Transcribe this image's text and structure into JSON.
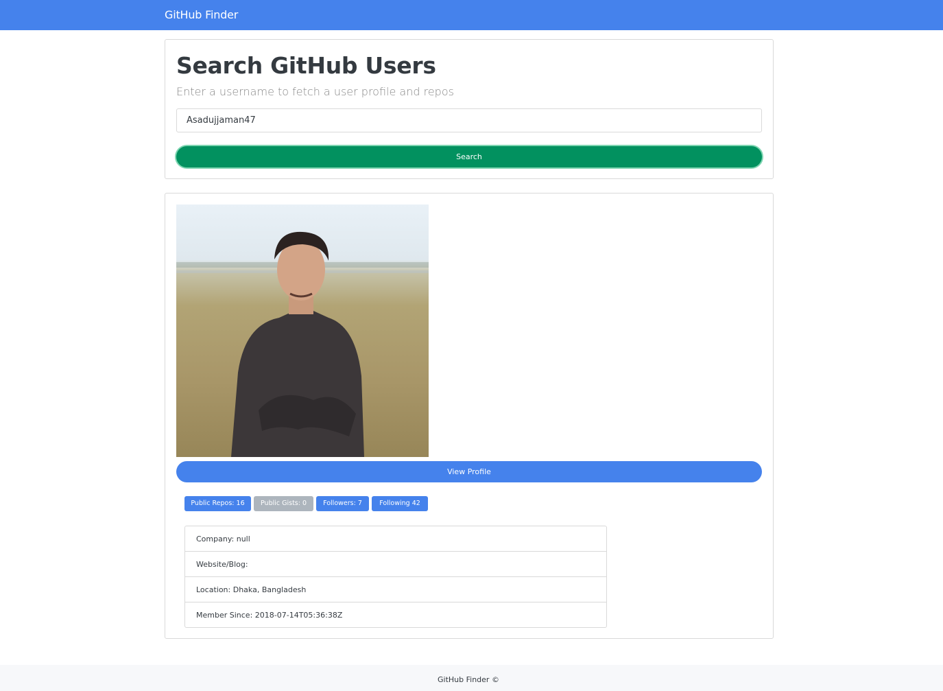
{
  "navbar": {
    "brand": "GitHub Finder"
  },
  "search": {
    "heading": "Search GitHub Users",
    "lead": "Enter a username to fetch a user profile and repos",
    "input_value": "Asadujjaman47",
    "button_label": "Search"
  },
  "profile": {
    "avatar_alt": "",
    "view_profile_label": "View Profile",
    "badges": [
      {
        "label": "Public Repos: 16",
        "color": "#4582ec"
      },
      {
        "label": "Public Gists: 0",
        "color": "#adb5bd"
      },
      {
        "label": "Followers: 7",
        "color": "#4582ec"
      },
      {
        "label": "Following 42",
        "color": "#4582ec"
      }
    ],
    "details": [
      "Company: null",
      "Website/Blog:",
      "Location: Dhaka, Bangladesh",
      "Member Since: 2018-07-14T05:36:38Z"
    ]
  },
  "footer": {
    "text": "GitHub Finder ©"
  },
  "colors": {
    "primary": "#4582ec",
    "success": "#02915f",
    "secondary": "#adb5bd",
    "footer_bg": "#f7f8fa"
  }
}
